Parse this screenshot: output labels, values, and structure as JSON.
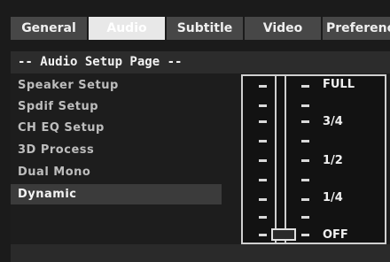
{
  "tabs": [
    {
      "label": "General",
      "active": false
    },
    {
      "label": "Audio",
      "active": true
    },
    {
      "label": "Subtitle",
      "active": false
    },
    {
      "label": "Video",
      "active": false
    },
    {
      "label": "Preference",
      "active": false
    }
  ],
  "page": {
    "title": "-- Audio Setup Page --"
  },
  "menu": {
    "items": [
      {
        "label": "Speaker Setup"
      },
      {
        "label": "Spdif Setup"
      },
      {
        "label": "CH EQ Setup"
      },
      {
        "label": "3D Process"
      },
      {
        "label": "Dual Mono"
      },
      {
        "label": "Dynamic",
        "selected": true
      }
    ]
  },
  "dynamic_slider": {
    "levels": [
      "FULL",
      "3/4",
      "1/2",
      "1/4",
      "OFF"
    ],
    "current": "OFF",
    "value_fraction": 0
  },
  "colors": {
    "tab_bar": "#474747",
    "tab_active": "#e8e8e8",
    "selected_row": "#3b3b3b"
  }
}
